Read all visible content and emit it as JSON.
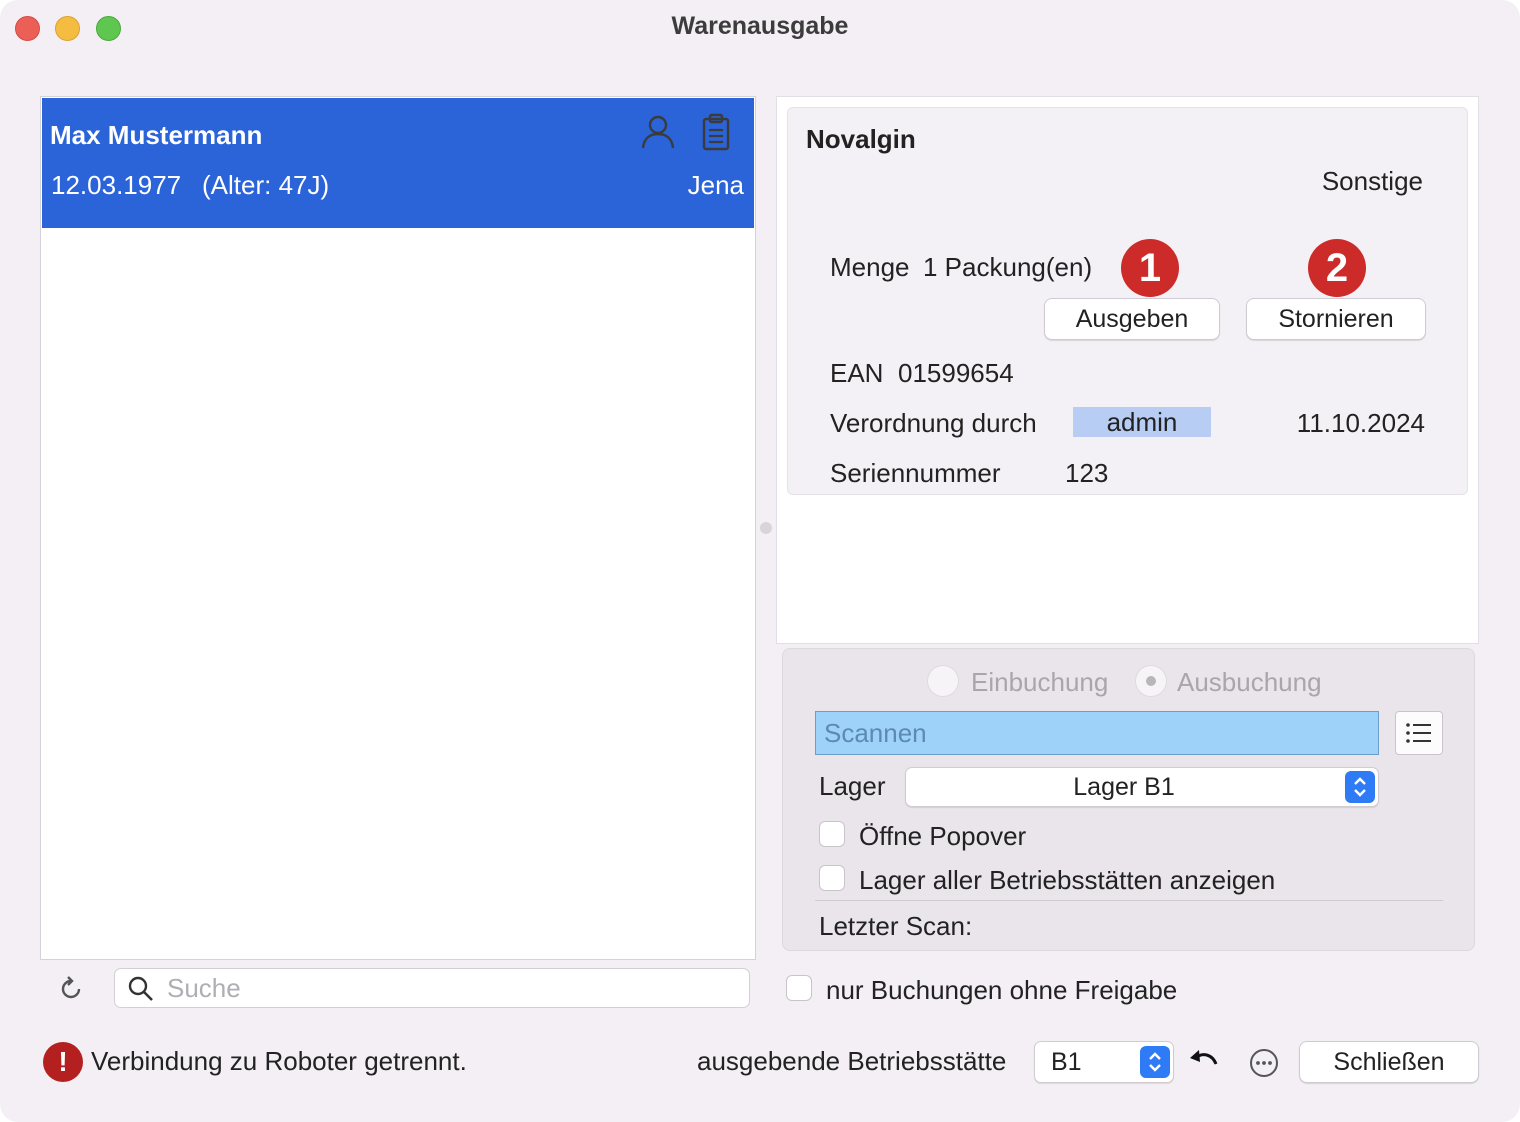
{
  "window": {
    "title": "Warenausgabe"
  },
  "patient": {
    "name": "Max Mustermann",
    "dob": "12.03.1977",
    "age": "(Alter: 47J)",
    "city": "Jena"
  },
  "detail": {
    "product": "Novalgin",
    "category": "Sonstige",
    "menge_label": "Menge",
    "menge_value": "1 Packung(en)",
    "ausgeben": "Ausgeben",
    "stornieren": "Stornieren",
    "badge1": "1",
    "badge2": "2",
    "ean_label": "EAN",
    "ean_value": "01599654",
    "verordnung_label": "Verordnung durch",
    "verordnung_user": "admin",
    "verordnung_date": "11.10.2024",
    "serien_label": "Seriennummer",
    "serien_value": "123"
  },
  "scan": {
    "radio_ein": "Einbuchung",
    "radio_aus": "Ausbuchung",
    "selected": "Ausbuchung",
    "placeholder": "Scannen",
    "lager_label": "Lager",
    "lager_value": "Lager B1",
    "cb_popover": "Öffne Popover",
    "cb_all": "Lager aller Betriebsstätten anzeigen",
    "last_scan": "Letzter Scan:"
  },
  "left": {
    "search_placeholder": "Suche"
  },
  "filter": {
    "only_unreleased": "nur Buchungen ohne Freigabe"
  },
  "footer": {
    "status": "Verbindung zu Roboter getrennt.",
    "alert_glyph": "!",
    "bst_label": "ausgebende Betriebsstätte",
    "bst_value": "B1",
    "close": "Schließen"
  },
  "colors": {
    "selection": "#2b63d9",
    "badge": "#cd2a2a",
    "scan_field": "#9fd2f8",
    "user_tag": "#b7cdf4",
    "alert": "#b3201f"
  }
}
